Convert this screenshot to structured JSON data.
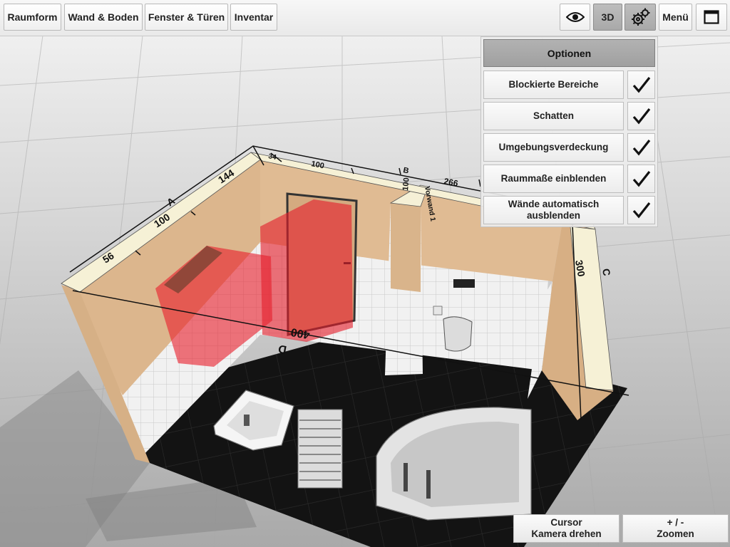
{
  "toolbar": {
    "raumform": "Raumform",
    "wand_boden": "Wand & Boden",
    "fenster_tueren": "Fenster & Türen",
    "inventar": "Inventar",
    "view_3d": "3D",
    "menu": "Menü"
  },
  "options_panel": {
    "title": "Optionen",
    "items": [
      {
        "label": "Blockierte Bereiche",
        "checked": true
      },
      {
        "label": "Schatten",
        "checked": true
      },
      {
        "label": "Umgebungsverdeckung",
        "checked": true
      },
      {
        "label": "Raummaße einblenden",
        "checked": true
      },
      {
        "label_line1": "Wände automatisch",
        "label_line2": "ausblenden",
        "checked": true
      }
    ]
  },
  "dimensions": {
    "wall_a": "A",
    "wall_b": "B",
    "wall_c": "C",
    "wall_d": "D",
    "a_56": "56",
    "a_100": "100",
    "a_144": "144",
    "b_34": "34",
    "b_100": "100",
    "b_266": "266",
    "c_300": "300",
    "d_400": "400",
    "vorwand_100": "100",
    "vorwand_label": "Vorwand 1"
  },
  "bottom_controls": {
    "cursor_line1": "Cursor",
    "cursor_line2": "Kamera drehen",
    "zoom_line1": "+ / -",
    "zoom_line2": "Zoomen"
  }
}
